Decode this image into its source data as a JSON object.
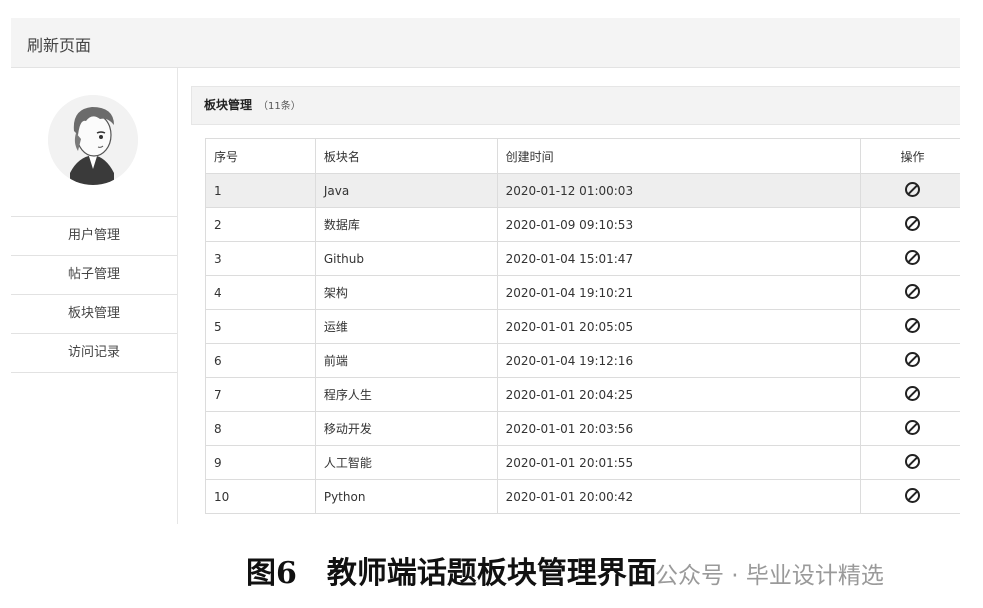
{
  "topbar": {
    "refresh_label": "刷新页面"
  },
  "sidebar": {
    "avatar_icon": "user-avatar-anime",
    "items": [
      {
        "label": "用户管理"
      },
      {
        "label": "帖子管理"
      },
      {
        "label": "板块管理"
      },
      {
        "label": "访问记录"
      }
    ]
  },
  "panel": {
    "title": "板块管理",
    "count": "（11条）",
    "columns": [
      "序号",
      "板块名",
      "创建时间",
      "操作"
    ],
    "rows": [
      {
        "id": "1",
        "name": "Java",
        "created": "2020-01-12 01:00:03"
      },
      {
        "id": "2",
        "name": "数据库",
        "created": "2020-01-09 09:10:53"
      },
      {
        "id": "3",
        "name": "Github",
        "created": "2020-01-04 15:01:47"
      },
      {
        "id": "4",
        "name": "架构",
        "created": "2020-01-04 19:10:21"
      },
      {
        "id": "5",
        "name": "运维",
        "created": "2020-01-01 20:05:05"
      },
      {
        "id": "6",
        "name": "前端",
        "created": "2020-01-04 19:12:16"
      },
      {
        "id": "7",
        "name": "程序人生",
        "created": "2020-01-01 20:04:25"
      },
      {
        "id": "8",
        "name": "移动开发",
        "created": "2020-01-01 20:03:56"
      },
      {
        "id": "9",
        "name": "人工智能",
        "created": "2020-01-01 20:01:55"
      },
      {
        "id": "10",
        "name": "Python",
        "created": "2020-01-01 20:00:42"
      }
    ],
    "op_icon": "ban-icon"
  },
  "caption": "图6　教师端话题板块管理界面",
  "watermark": "公众号 · 毕业设计精选"
}
